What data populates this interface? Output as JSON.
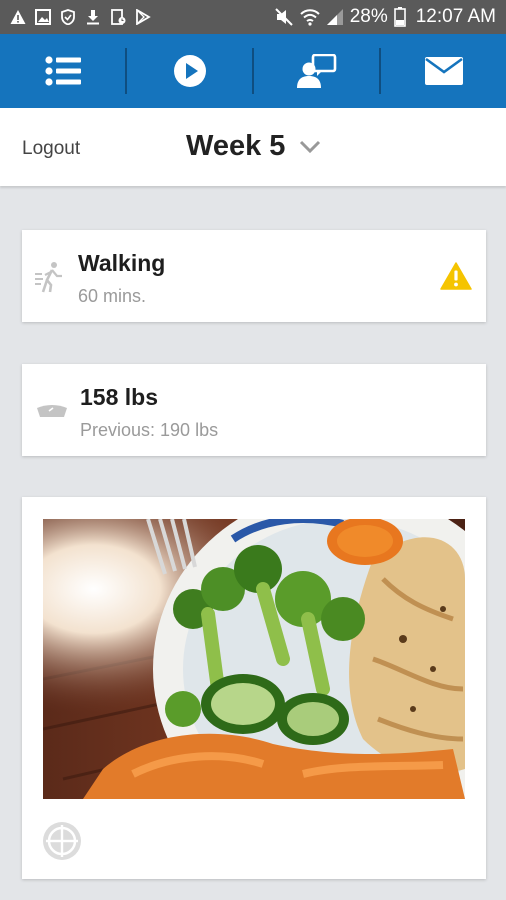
{
  "status_bar": {
    "battery": "28%",
    "time": "12:07 AM",
    "left_icons": [
      "warning-icon",
      "image-icon",
      "shield-icon",
      "download-icon",
      "clipboard-icon",
      "play-store-icon"
    ],
    "right_icons": [
      "mute-icon",
      "wifi-icon",
      "signal-icon",
      "battery-icon"
    ]
  },
  "nav": {
    "color": "#1574bd",
    "items": [
      {
        "icon": "list-icon"
      },
      {
        "icon": "play-icon"
      },
      {
        "icon": "chat-user-icon"
      },
      {
        "icon": "mail-icon"
      }
    ]
  },
  "header": {
    "logout_label": "Logout",
    "week_label": "Week 5"
  },
  "activity": {
    "title": "Walking",
    "subtitle": "60 mins.",
    "icon": "walking-icon",
    "alert_icon": "warning-icon",
    "alert_color": "#f5c400"
  },
  "weight": {
    "title": "158 lbs",
    "subtitle": "Previous: 190 lbs",
    "icon": "scale-icon"
  },
  "meal": {
    "image": "meal-photo",
    "icon": "plate-icon"
  }
}
